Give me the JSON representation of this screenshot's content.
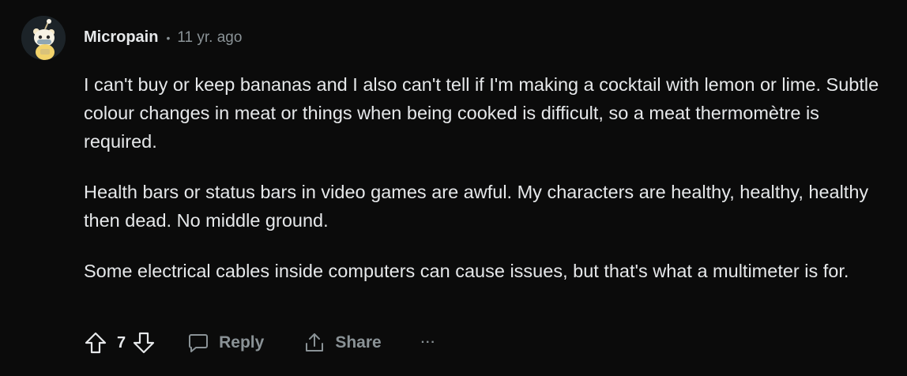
{
  "comment": {
    "author": "Micropain",
    "separator": "•",
    "timestamp": "11 yr. ago",
    "paragraphs": [
      "I can't buy or keep bananas and I also can't tell if I'm making a cocktail with lemon or lime. Subtle colour changes in meat or things when being cooked is difficult, so a meat thermomètre is required.",
      "Health bars or status bars in video games are awful. My characters are healthy, healthy, healthy then dead. No middle ground.",
      "Some electrical cables inside computers can cause issues, but that's what a multimeter is for."
    ],
    "score": "7",
    "reply_label": "Reply",
    "share_label": "Share",
    "more_label": "···"
  },
  "icons": {
    "upvote": "upvote-arrow-icon",
    "downvote": "downvote-arrow-icon",
    "reply": "speech-bubble-icon",
    "share": "share-upload-icon",
    "avatar": "snoo-avatar"
  },
  "colors": {
    "background": "#0b0b0b",
    "text": "#e6e8ea",
    "muted": "#8a9296"
  }
}
